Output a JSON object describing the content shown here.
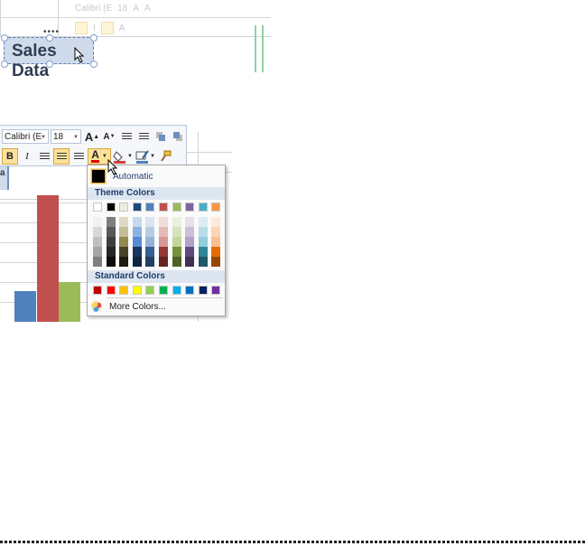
{
  "top_toolbar": {
    "font_name": "Calibri (E",
    "font_size": "18"
  },
  "chart_title": "Sales Data",
  "toolbar": {
    "font_name": "Calibri (E",
    "font_size": "18",
    "grow_font_label": "A",
    "shrink_font_label": "A",
    "bold_label": "B",
    "italic_label": "I",
    "font_color_label": "A"
  },
  "font_color_menu": {
    "automatic_label": "Automatic",
    "theme_colors_label": "Theme Colors",
    "standard_colors_label": "Standard Colors",
    "more_colors_label": "More Colors...",
    "theme_base": [
      "#FFFFFF",
      "#000000",
      "#EEECE1",
      "#1F497D",
      "#4F81BD",
      "#C0504D",
      "#9BBB59",
      "#8064A2",
      "#4BACC6",
      "#F79646"
    ],
    "theme_shades": [
      [
        "#F2F2F2",
        "#7F7F7F",
        "#DDD9C3",
        "#C6D9F0",
        "#DBE5F1",
        "#F2DCDB",
        "#EBF1DD",
        "#E5E0EC",
        "#DBEEF3",
        "#FDEADA"
      ],
      [
        "#D8D8D8",
        "#595959",
        "#C4BD97",
        "#8DB3E2",
        "#B8CCE4",
        "#E5B9B7",
        "#D7E3BC",
        "#CCC1D9",
        "#B7DDE8",
        "#FBD5B5"
      ],
      [
        "#BFBFBF",
        "#3F3F3F",
        "#938953",
        "#548DD4",
        "#95B3D7",
        "#D99694",
        "#C3D69B",
        "#B2A2C7",
        "#92CDDC",
        "#FAC08F"
      ],
      [
        "#A5A5A5",
        "#262626",
        "#494429",
        "#17365D",
        "#366092",
        "#953734",
        "#76923C",
        "#5F497A",
        "#31859B",
        "#E36C09"
      ],
      [
        "#7F7F7F",
        "#0C0C0C",
        "#1D1B10",
        "#0F243E",
        "#244061",
        "#632423",
        "#4F6128",
        "#3F3151",
        "#205867",
        "#974806"
      ]
    ],
    "standard": [
      "#C00000",
      "#FF0000",
      "#FFC000",
      "#FFFF00",
      "#92D050",
      "#00B050",
      "#00B0F0",
      "#0070C0",
      "#002060",
      "#7030A0"
    ]
  },
  "chart_data": {
    "type": "bar",
    "categories": [],
    "series": [
      {
        "values": [
          30
        ],
        "color": "#4F81BD"
      },
      {
        "values": [
          122
        ],
        "color": "#C0504D"
      },
      {
        "values": [
          38
        ],
        "color": "#9BBB59"
      }
    ],
    "ylim": [
      0,
      130
    ]
  }
}
